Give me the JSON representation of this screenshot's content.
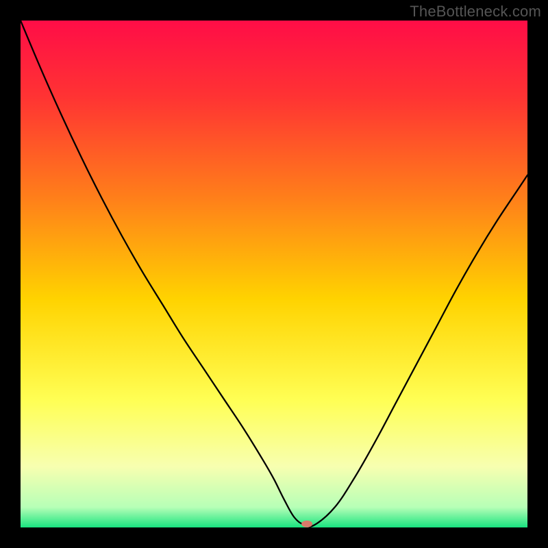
{
  "watermark": "TheBottleneck.com",
  "chart_data": {
    "type": "line",
    "title": "",
    "xlabel": "",
    "ylabel": "",
    "xlim": [
      0,
      100
    ],
    "ylim": [
      0,
      100
    ],
    "background_gradient": {
      "stops": [
        {
          "offset": 0.0,
          "color": "#ff0d47"
        },
        {
          "offset": 0.15,
          "color": "#ff3333"
        },
        {
          "offset": 0.35,
          "color": "#ff7f1a"
        },
        {
          "offset": 0.55,
          "color": "#ffd300"
        },
        {
          "offset": 0.75,
          "color": "#ffff55"
        },
        {
          "offset": 0.88,
          "color": "#f7ffb0"
        },
        {
          "offset": 0.96,
          "color": "#b7ffb7"
        },
        {
          "offset": 1.0,
          "color": "#19e37f"
        }
      ]
    },
    "series": [
      {
        "name": "bottleneck-curve",
        "color": "#000000",
        "stroke_width": 2.3,
        "x": [
          0,
          4,
          8,
          12,
          16,
          20,
          24,
          28,
          32,
          36,
          40,
          44,
          48,
          50,
          52,
          54,
          56,
          58,
          62,
          66,
          70,
          74,
          78,
          82,
          86,
          90,
          94,
          98,
          100
        ],
        "y": [
          100,
          90.5,
          81.5,
          73,
          65,
          57.5,
          50.5,
          44,
          37.5,
          31.5,
          25.5,
          19.5,
          13,
          9.5,
          5.5,
          2,
          0.5,
          0.5,
          4,
          10,
          17,
          24.5,
          32,
          39.5,
          47,
          54,
          60.5,
          66.5,
          69.5
        ]
      }
    ],
    "marker": {
      "name": "optimum-marker",
      "x": 56.5,
      "y": 0.7,
      "rx": 8,
      "ry": 5,
      "color": "#d97a6a"
    }
  }
}
